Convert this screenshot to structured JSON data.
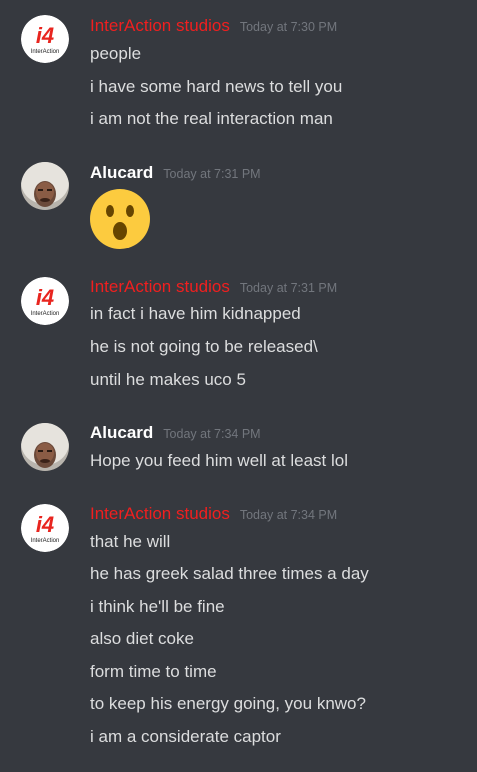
{
  "messages": [
    {
      "author": "InterAction studios",
      "author_color": "#f01f1f",
      "avatar": "interaction-logo",
      "timestamp": "Today at 7:30 PM",
      "lines": [
        "people",
        "i have some hard news to tell you",
        "i am not the real interaction man"
      ]
    },
    {
      "author": "Alucard",
      "author_color": "#ffffff",
      "avatar": "alucard-photo",
      "timestamp": "Today at 7:31 PM",
      "emoji": "astonished-face-emoji"
    },
    {
      "author": "InterAction studios",
      "author_color": "#f01f1f",
      "avatar": "interaction-logo",
      "timestamp": "Today at 7:31 PM",
      "lines": [
        "in fact i have him kidnapped",
        "he is not going to be released\\",
        "until he makes uco 5"
      ]
    },
    {
      "author": "Alucard",
      "author_color": "#ffffff",
      "avatar": "alucard-photo",
      "timestamp": "Today at 7:34 PM",
      "lines": [
        "Hope you feed him well at least lol"
      ]
    },
    {
      "author": "InterAction studios",
      "author_color": "#f01f1f",
      "avatar": "interaction-logo",
      "timestamp": "Today at 7:34 PM",
      "lines": [
        "that he will",
        "he has greek salad three times a day",
        "i think he'll be fine",
        "also diet coke",
        "form time to time",
        "to keep his energy going, you knwo?",
        "i am a considerate captor"
      ]
    }
  ],
  "logo_text": {
    "mark": "i4",
    "name": "InterAction"
  }
}
